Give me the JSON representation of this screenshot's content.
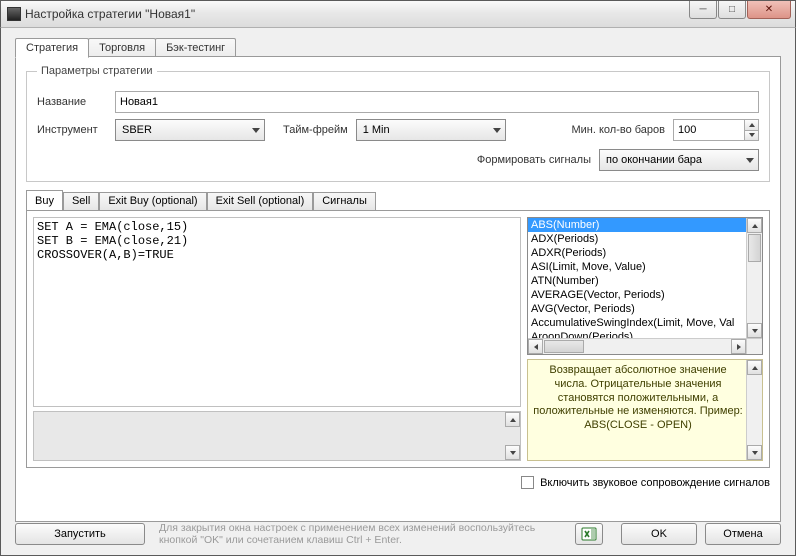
{
  "window": {
    "title": "Настройка стратегии \"Новая1\"",
    "buttons": {
      "min": "─",
      "max": "□",
      "close": "✕"
    }
  },
  "tabs": [
    "Стратегия",
    "Торговля",
    "Бэк-тестинг"
  ],
  "active_tab_index": 0,
  "params": {
    "legend": "Параметры стратегии",
    "name_label": "Название",
    "name_value": "Новая1",
    "instrument_label": "Инструмент",
    "instrument_value": "SBER",
    "timeframe_label": "Тайм-фрейм",
    "timeframe_value": "1 Min",
    "minbars_label": "Мин. кол-во баров",
    "minbars_value": "100",
    "signals_label": "Формировать сигналы",
    "signals_value": "по окончании бара"
  },
  "inner_tabs": [
    "Buy",
    "Sell",
    "Exit Buy (optional)",
    "Exit Sell (optional)",
    "Сигналы"
  ],
  "active_inner_tab_index": 0,
  "code": "SET A = EMA(close,15)\nSET B = EMA(close,21)\nCROSSOVER(A,B)=TRUE",
  "functions": {
    "items": [
      "ABS(Number)",
      "ADX(Periods)",
      "ADXR(Periods)",
      "ASI(Limit, Move, Value)",
      "ATN(Number)",
      "AVERAGE(Vector, Periods)",
      "AVG(Vector, Periods)",
      "AccumulativeSwingIndex(Limit, Move, Val",
      "AroonDown(Periods)"
    ],
    "selected_index": 0,
    "description": "Возвращает абсолютное значение числа. Отрицательные значения становятся положительными, а положительные не изменяются.\nПример:\nABS(CLOSE - OPEN)"
  },
  "sound_checkbox": {
    "label": "Включить звуковое сопровождение сигналов",
    "checked": false
  },
  "footer": {
    "run": "Запустить",
    "hint": "Для закрытия окна настроек с применением всех изменений воспользуйтесь кнопкой \"OK\" или сочетанием клавиш Ctrl + Enter.",
    "ok": "OK",
    "cancel": "Отмена"
  }
}
